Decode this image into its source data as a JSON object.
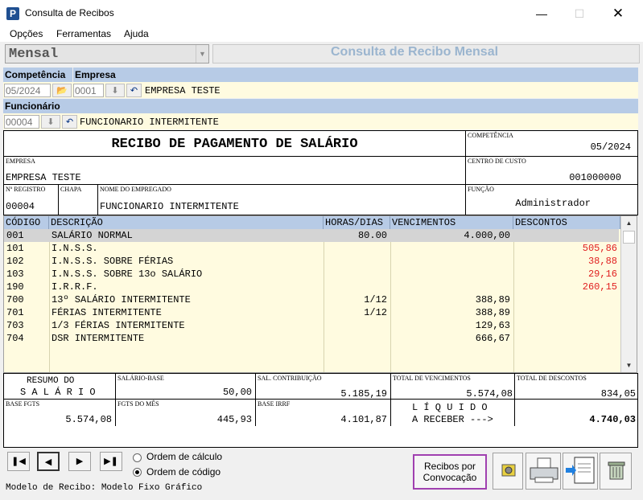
{
  "window": {
    "title": "Consulta de Recibos",
    "app_icon": "P"
  },
  "menu": [
    "Opções",
    "Ferramentas",
    "Ajuda"
  ],
  "mode_select": {
    "value": "Mensal"
  },
  "header_title": "Consulta de Recibo Mensal",
  "labels": {
    "competencia": "Competência",
    "empresa": "Empresa",
    "funcionario": "Funcionário"
  },
  "filters": {
    "competencia": "05/2024",
    "empresa_code": "0001",
    "empresa_name": "EMPRESA TESTE",
    "funcionario_code": "00004",
    "funcionario_name": "FUNCIONARIO INTERMITENTE"
  },
  "receipt": {
    "title": "RECIBO DE PAGAMENTO DE SALÁRIO",
    "competencia_label": "COMPETÊNCIA",
    "competencia": "05/2024",
    "empresa_label": "EMPRESA",
    "empresa": "EMPRESA TESTE",
    "centro_custo_label": "CENTRO DE CUSTO",
    "centro_custo": "001000000",
    "registro_label": "Nº REGISTRO",
    "registro": "00004",
    "chapa_label": "CHAPA",
    "nome_label": "NOME DO EMPREGADO",
    "nome": "FUNCIONARIO INTERMITENTE",
    "funcao_label": "FUNÇÃO",
    "funcao": "Administrador"
  },
  "table": {
    "headers": [
      "CÓDIGO",
      "DESCRIÇÃO",
      "HORAS/DIAS",
      "VENCIMENTOS",
      "DESCONTOS"
    ],
    "rows": [
      {
        "codigo": "001",
        "descricao": "SALÁRIO NORMAL",
        "horas": "80.00",
        "vencimentos": "4.000,00",
        "descontos": ""
      },
      {
        "codigo": "101",
        "descricao": "I.N.S.S.",
        "horas": "",
        "vencimentos": "",
        "descontos": "505,86"
      },
      {
        "codigo": "102",
        "descricao": "I.N.S.S. SOBRE FÉRIAS",
        "horas": "",
        "vencimentos": "",
        "descontos": "38,88"
      },
      {
        "codigo": "103",
        "descricao": "I.N.S.S. SOBRE 13o SALÁRIO",
        "horas": "",
        "vencimentos": "",
        "descontos": "29,16"
      },
      {
        "codigo": "190",
        "descricao": "I.R.R.F.",
        "horas": "",
        "vencimentos": "",
        "descontos": "260,15"
      },
      {
        "codigo": "700",
        "descricao": "13º SALÁRIO INTERMITENTE",
        "horas": "1/12",
        "vencimentos": "388,89",
        "descontos": ""
      },
      {
        "codigo": "701",
        "descricao": "FÉRIAS INTERMITENTE",
        "horas": "1/12",
        "vencimentos": "388,89",
        "descontos": ""
      },
      {
        "codigo": "703",
        "descricao": "1/3 FÉRIAS INTERMITENTE",
        "horas": "",
        "vencimentos": "129,63",
        "descontos": ""
      },
      {
        "codigo": "704",
        "descricao": "DSR INTERMITENTE",
        "horas": "",
        "vencimentos": "666,67",
        "descontos": ""
      }
    ]
  },
  "summary": {
    "resumo_line1": "RESUMO DO",
    "resumo_line2": "S A L Á R I O",
    "salario_base_label": "SALÁRIO-BASE",
    "salario_base": "50,00",
    "sal_contribuicao_label": "SAL. CONTRIBUIÇÃO",
    "sal_contribuicao": "5.185,19",
    "total_vencimentos_label": "TOTAL DE VENCIMENTOS",
    "total_vencimentos": "5.574,08",
    "total_descontos_label": "TOTAL DE DESCONTOS",
    "total_descontos": "834,05",
    "base_fgts_label": "BASE FGTS",
    "base_fgts": "5.574,08",
    "fgts_mes_label": "FGTS DO MÊS",
    "fgts_mes": "445,93",
    "base_irrf_label": "BASE IRRF",
    "base_irrf": "4.101,87",
    "liquido_line1": "L Í Q U I D O",
    "liquido_line2": "A RECEBER --->",
    "liquido": "4.740,03"
  },
  "ordering": {
    "option1": "Ordem de cálculo",
    "option2": "Ordem de código",
    "selected": "Ordem de código"
  },
  "recibos_button": {
    "line1": "Recibos por",
    "line2": "Convocação"
  },
  "status": "Modelo de Recibo: Modelo Fixo Gráfico",
  "colors": {
    "blue_bar": "#b7cbe6",
    "yellow_row": "#fffbe0",
    "red_value": "#e02020",
    "highlight_border": "#a040b0"
  }
}
